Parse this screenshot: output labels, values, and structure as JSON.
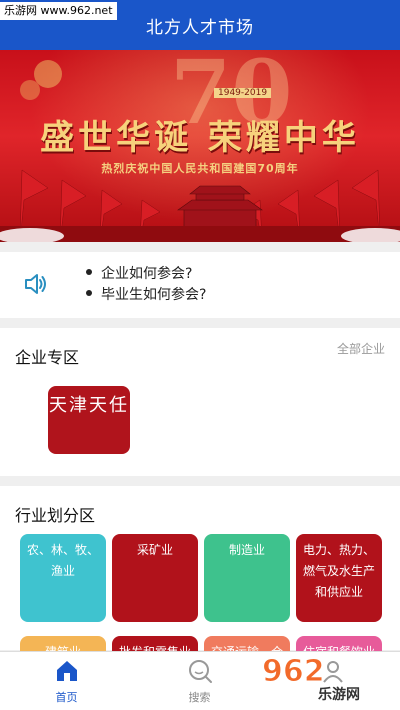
{
  "watermark": "乐游网 www.962.net",
  "header": {
    "title": "北方人才市场"
  },
  "banner": {
    "big_number": "70",
    "years": "1949-2019",
    "headline": "盛世华诞 荣耀中华",
    "subtitle": "热烈庆祝中国人民共和国建国70周年"
  },
  "notice": {
    "icon": "speaker-icon",
    "items": [
      "企业如何参会?",
      "毕业生如何参会?"
    ]
  },
  "enterprise": {
    "title": "企业专区",
    "more": "全部企业",
    "cards": [
      "天津天任"
    ]
  },
  "industry": {
    "title": "行业划分区",
    "tiles": [
      {
        "label": "农、林、牧、渔业",
        "color": "#3fc3cf"
      },
      {
        "label": "采矿业",
        "color": "#b1121b"
      },
      {
        "label": "制造业",
        "color": "#3ec28d"
      },
      {
        "label": "电力、热力、燃气及水生产和供应业",
        "color": "#b1121b"
      },
      {
        "label": "建筑业",
        "color": "#f4b555"
      },
      {
        "label": "批发和零售业",
        "color": "#b1121b"
      },
      {
        "label": "交通运输、仓",
        "color": "#f07b5e"
      },
      {
        "label": "住宿和餐饮业",
        "color": "#e75b9a"
      }
    ]
  },
  "tabbar": {
    "tabs": [
      {
        "label": "首页",
        "icon": "home-icon",
        "active": true
      },
      {
        "label": "搜索",
        "icon": "search-icon",
        "active": false
      },
      {
        "label": "",
        "icon": "user-icon",
        "active": false
      }
    ]
  },
  "corner_watermark": {
    "number": "962",
    "text": "乐游网"
  },
  "colors": {
    "primary": "#1a56c9",
    "brand_red": "#b0141c"
  }
}
